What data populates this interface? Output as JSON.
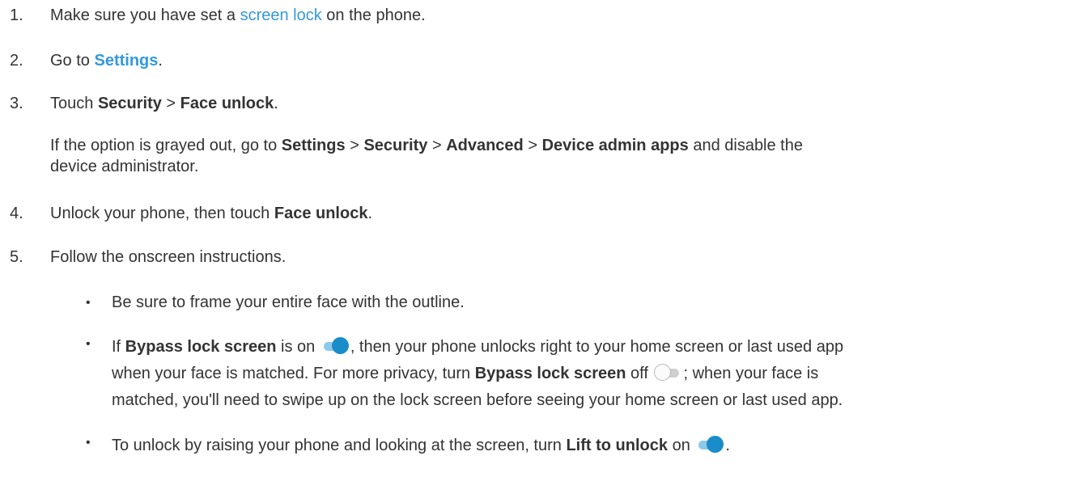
{
  "colors": {
    "text": "#333333",
    "link": "#3399dd",
    "toggle_on_knob": "#1a8cc9",
    "toggle_on_track": "#8cc9ea",
    "toggle_off_track": "#cfcfcf"
  },
  "steps": [
    {
      "number": "1.",
      "text_before": "Make sure you have set a ",
      "link": "screen lock",
      "text_after": " on the phone."
    },
    {
      "number": "2.",
      "text_before": "Go to ",
      "link": "Settings",
      "text_after": "."
    },
    {
      "number": "3.",
      "text_before": "Touch ",
      "bold1": "Security",
      "sep1": " > ",
      "bold2": "Face unlock",
      "text_after": ".",
      "note": {
        "t1": "If the option is grayed out, go to ",
        "b1": "Settings",
        "s1": " > ",
        "b2": "Security",
        "s2": " > ",
        "b3": "Advanced",
        "s3": " > ",
        "b4": "Device admin apps",
        "t2": " and disable the",
        "t3": "device administrator."
      }
    },
    {
      "number": "4.",
      "text_before": "Unlock your phone, then touch ",
      "bold1": "Face unlock",
      "text_after": "."
    },
    {
      "number": "5.",
      "text": "Follow the onscreen instructions."
    }
  ],
  "bullets": [
    {
      "symbol": "•",
      "text": "Be sure to frame your entire face with the outline."
    },
    {
      "symbol": "•",
      "l1_t1": "If ",
      "l1_b1": "Bypass lock screen",
      "l1_t2": " is on ",
      "l1_t3": ", then your phone unlocks right to your home screen or last used app",
      "l2_t1": "when your face is matched. For more privacy, turn ",
      "l2_b1": "Bypass lock screen",
      "l2_t2": " off ",
      "l2_t3": "; when your face is",
      "l3": "matched, you'll need to swipe up on the lock screen before seeing your home screen or last used app."
    },
    {
      "symbol": "•",
      "t1": "To unlock by raising your phone and looking at the screen, turn ",
      "b1": "Lift to unlock",
      "t2": " on ",
      "t3": "."
    }
  ],
  "toggles": {
    "bypass_on": "on",
    "bypass_off": "off",
    "lift_on": "on"
  }
}
